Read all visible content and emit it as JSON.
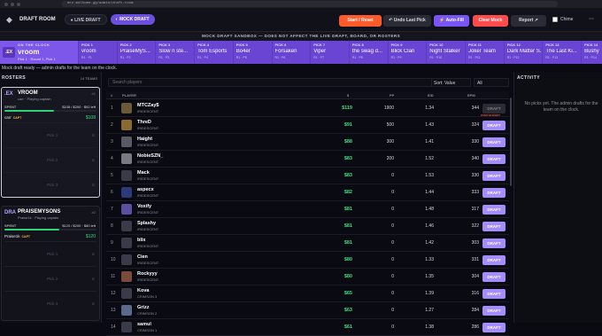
{
  "browser": {
    "url": "mrz.mdlhome.gg/admin/draft-room"
  },
  "header": {
    "title": "DRAFT ROOM",
    "tab_live": "● LIVE DRAFT",
    "tab_mock": "◐ MOCK DRAFT",
    "btn_start": "Start / Reset",
    "btn_undo": "↶ Undo Last Pick",
    "btn_auto": "⚡ Auto-Fill",
    "btn_clear": "Clear Mock",
    "btn_report": "Report ↗",
    "chime": "Chime",
    "more": "⋯"
  },
  "banner": "MOCK DRAFT SANDBOX — DOES NOT AFFECT THE LIVE DRAFT, BOARD, OR ROSTERS",
  "on_clock": {
    "label": "ON THE CLOCK",
    "abbr": ".EX",
    "team": "vroom",
    "pick": "Pick 1 · Round 1, Pick 1"
  },
  "picks": [
    {
      "label": "PICK 1",
      "team": "vroom",
      "sub": "R1 · P1"
    },
    {
      "label": "PICK 2",
      "team": "PraiseMyS...",
      "sub": "R1 · P2"
    },
    {
      "label": "PICK 3",
      "team": "Slow n ste...",
      "sub": "R1 · P3"
    },
    {
      "label": "PICK 4",
      "team": "Tom Esports",
      "sub": "R1 · P4"
    },
    {
      "label": "PICK 5",
      "team": "Bo4er",
      "sub": "R1 · P5"
    },
    {
      "label": "PICK 6",
      "team": "Forsaken",
      "sub": "R1 · P6"
    },
    {
      "label": "PICK 7",
      "team": "Viper",
      "sub": "R1 · P7"
    },
    {
      "label": "PICK 8",
      "team": "the swag d...",
      "sub": "R1 · P8"
    },
    {
      "label": "PICK 9",
      "team": "Blick Clan",
      "sub": "R1 · P9"
    },
    {
      "label": "PICK 10",
      "team": "Night Stalker",
      "sub": "R1 · P10"
    },
    {
      "label": "PICK 11",
      "team": "Joker Team",
      "sub": "R1 · P11"
    },
    {
      "label": "PICK 12",
      "team": "Dark Matter S...",
      "sub": "R1 · P12"
    },
    {
      "label": "PICK 13",
      "team": "The Last Ki...",
      "sub": "R1 · P13"
    },
    {
      "label": "PICK 14",
      "team": "Bushy",
      "sub": "R1 · P14"
    }
  ],
  "status_msg": "Mock draft ready — admin drafts for the team on the clock.",
  "rosters": {
    "heading": "ROSTERS",
    "count": "14 TEAMS",
    "teams": [
      {
        "abbr": ".EX",
        "name": "VROOM",
        "sub": "carr · Playing captain",
        "seed": "#1",
        "spent_label": "SPENT",
        "budget": "$108 / $200 · $92 left",
        "spent_fraction": 0.54,
        "player": "carr",
        "capt": "CAPT",
        "price": "$108",
        "slots": [
          "Pick 1",
          "Pick 2",
          "Pick 3"
        ],
        "slot_icon": "⊠"
      },
      {
        "abbr": "DRA",
        "name": "PRAISEMYSONS",
        "sub": "Praise1k · Playing captain",
        "seed": "#2",
        "spent_label": "SPENT",
        "budget": "$120 / $200 · $80 left",
        "spent_fraction": 0.6,
        "player": "Praise1k",
        "capt": "CAPT",
        "price": "$120",
        "slots": [
          "Pick 1",
          "Pick 2",
          "Pick 3"
        ],
        "slot_icon": "⊠"
      }
    ]
  },
  "main": {
    "search_placeholder": "Search players",
    "sort": "Sort: Value",
    "filter": "All",
    "headers": {
      "num": "#",
      "player": "PLAYER",
      "price": "$",
      "pp": "PP",
      "ed": "E/D",
      "epm": "EPM"
    },
    "over_budget": "OVER BUDGET",
    "rows": [
      {
        "num": "1",
        "name": "MTCZay$",
        "team": "IRIDESCENT",
        "price": "$119",
        "pp": "1900",
        "ed": "1.34",
        "epm": "344",
        "action": "DRAFT",
        "disabled": true,
        "av": "#6a5a3a"
      },
      {
        "num": "2",
        "name": "ThreD",
        "team": "IRIDESCENT",
        "price": "$91",
        "pp": "500",
        "ed": "1.43",
        "epm": "324",
        "action": "DRAFT",
        "disabled": false,
        "av": "#8a6a30"
      },
      {
        "num": "3",
        "name": "Haight",
        "team": "IRIDESCENT",
        "price": "$88",
        "pp": "300",
        "ed": "1.41",
        "epm": "330",
        "action": "DRAFT",
        "disabled": false,
        "av": "#5a5a66"
      },
      {
        "num": "4",
        "name": "NobieSZN_",
        "team": "IRIDESCENT",
        "price": "$83",
        "pp": "200",
        "ed": "1.52",
        "epm": "340",
        "action": "DRAFT",
        "disabled": false,
        "av": "#7a7a80"
      },
      {
        "num": "5",
        "name": "Mack",
        "team": "IRIDESCENT",
        "price": "$83",
        "pp": "0",
        "ed": "1.53",
        "epm": "330",
        "action": "DRAFT",
        "disabled": false,
        "av": "#3a3b48"
      },
      {
        "num": "6",
        "name": "aspecx",
        "team": "IRIDESCENT",
        "price": "$82",
        "pp": "0",
        "ed": "1.44",
        "epm": "333",
        "action": "DRAFT",
        "disabled": false,
        "av": "#2a3a7a"
      },
      {
        "num": "7",
        "name": "Voxify",
        "team": "IRIDESCENT",
        "price": "$81",
        "pp": "0",
        "ed": "1.48",
        "epm": "317",
        "action": "DRAFT",
        "disabled": false,
        "av": "#5a4fa0"
      },
      {
        "num": "8",
        "name": "Splashy",
        "team": "IRIDESCENT",
        "price": "$81",
        "pp": "0",
        "ed": "1.46",
        "epm": "322",
        "action": "DRAFT",
        "disabled": false,
        "av": "#3a3b48"
      },
      {
        "num": "9",
        "name": "blix",
        "team": "IRIDESCENT",
        "price": "$81",
        "pp": "0",
        "ed": "1.42",
        "epm": "303",
        "action": "DRAFT",
        "disabled": false,
        "av": "#3a3b48"
      },
      {
        "num": "10",
        "name": "Cien",
        "team": "IRIDESCENT",
        "price": "$80",
        "pp": "0",
        "ed": "1.33",
        "epm": "331",
        "action": "DRAFT",
        "disabled": false,
        "av": "#3a3b48"
      },
      {
        "num": "11",
        "name": "Rockyyy",
        "team": "IRIDESCENT",
        "price": "$80",
        "pp": "0",
        "ed": "1.35",
        "epm": "304",
        "action": "DRAFT",
        "disabled": false,
        "av": "#7a4a3a"
      },
      {
        "num": "12",
        "name": "Kova",
        "team": "CRIMSON 3",
        "price": "$65",
        "pp": "0",
        "ed": "1.39",
        "epm": "316",
        "action": "DRAFT",
        "disabled": false,
        "av": "#3a3b48"
      },
      {
        "num": "13",
        "name": "Grizz",
        "team": "CRIMSON 2",
        "price": "$63",
        "pp": "0",
        "ed": "1.27",
        "epm": "284",
        "action": "DRAFT",
        "disabled": false,
        "av": "#5a6a8a"
      },
      {
        "num": "14",
        "name": "samul",
        "team": "CRIMSON 1",
        "price": "$61",
        "pp": "0",
        "ed": "1.38",
        "epm": "286",
        "action": "DRAFT",
        "disabled": false,
        "av": "#3a3b48"
      }
    ]
  },
  "activity": {
    "heading": "ACTIVITY",
    "message": "No picks yet. The admin drafts for the team on the clock."
  }
}
